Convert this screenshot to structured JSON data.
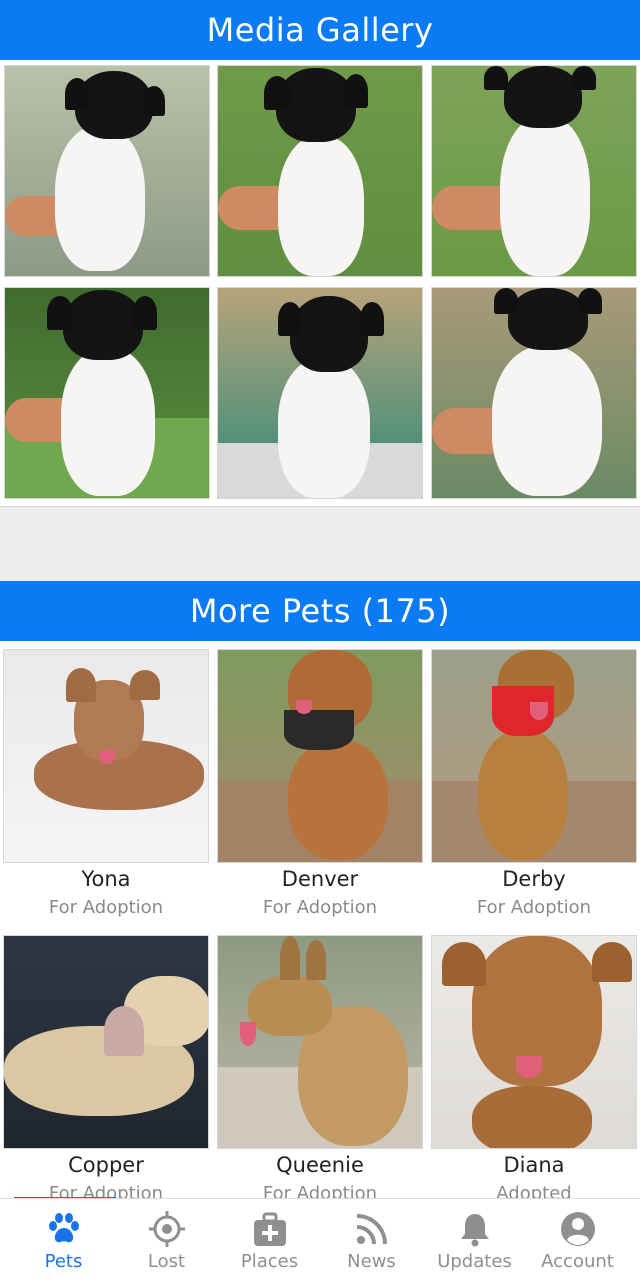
{
  "gallery": {
    "title": "Media Gallery",
    "photo_count": 6
  },
  "more_pets": {
    "title": "More Pets (175)",
    "pets": [
      {
        "name": "Yona",
        "status": "For Adoption"
      },
      {
        "name": "Denver",
        "status": "For Adoption"
      },
      {
        "name": "Derby",
        "status": "For Adoption"
      },
      {
        "name": "Copper",
        "status": "For Adoption"
      },
      {
        "name": "Queenie",
        "status": "For Adoption"
      },
      {
        "name": "Diana",
        "status": "Adopted"
      }
    ]
  },
  "tabs": [
    {
      "label": "Pets",
      "icon": "paw-icon",
      "active": true
    },
    {
      "label": "Lost",
      "icon": "target-icon",
      "active": false
    },
    {
      "label": "Places",
      "icon": "medical-bag-icon",
      "active": false
    },
    {
      "label": "News",
      "icon": "rss-icon",
      "active": false
    },
    {
      "label": "Updates",
      "icon": "bell-icon",
      "active": false
    },
    {
      "label": "Account",
      "icon": "account-icon",
      "active": false
    }
  ],
  "colors": {
    "header_blue": "#0a7bf5",
    "tab_active": "#1a73e8",
    "tab_inactive": "#8f8f8f"
  }
}
